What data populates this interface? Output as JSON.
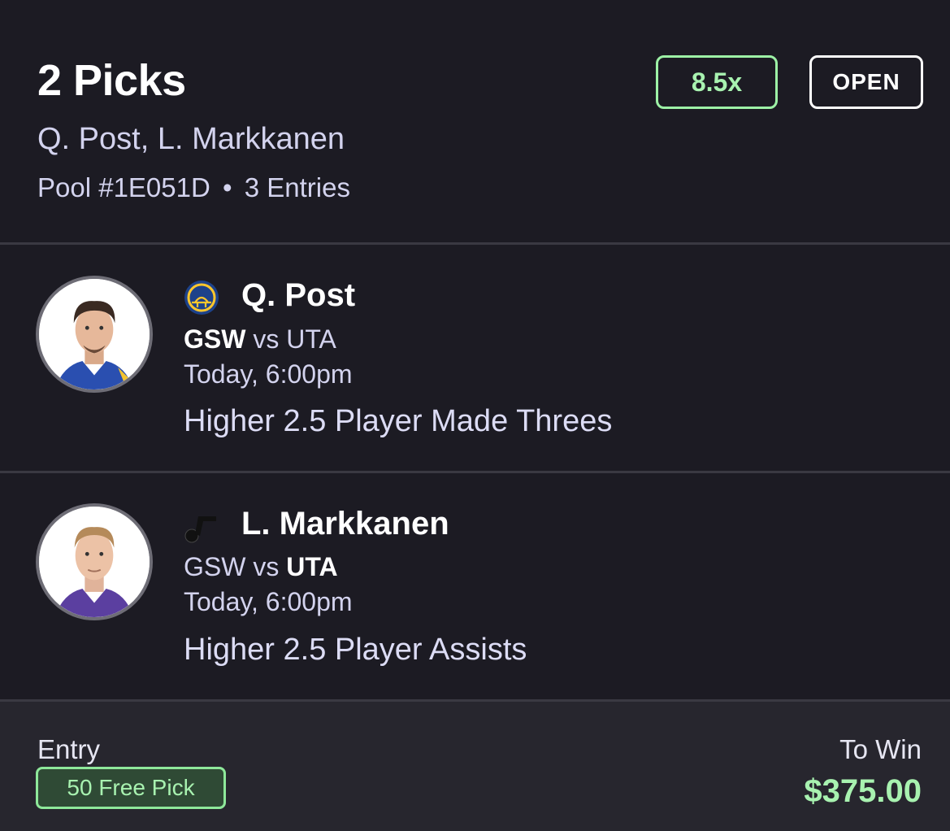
{
  "header": {
    "title": "2 Picks",
    "players": "Q. Post, L. Markkanen",
    "pool": "Pool #1E051D",
    "separator": "•",
    "entries": "3 Entries",
    "multiplier": "8.5x",
    "status": "OPEN"
  },
  "picks": [
    {
      "player": "Q. Post",
      "team_logo_icon": "warriors-logo-icon",
      "home_team": "GSW",
      "vs": "vs",
      "away_team": "UTA",
      "bold_team": "home",
      "time": "Today, 6:00pm",
      "line": "Higher 2.5 Player Made Threes",
      "jersey_color": "#2a4fb0"
    },
    {
      "player": "L. Markkanen",
      "team_logo_icon": "jazz-logo-icon",
      "home_team": "GSW",
      "vs": "vs",
      "away_team": "UTA",
      "bold_team": "away",
      "time": "Today, 6:00pm",
      "line": "Higher 2.5 Player Assists",
      "jersey_color": "#5b3fa0"
    }
  ],
  "footer": {
    "entry_label": "Entry",
    "entry_value": "50 Free Pick",
    "to_win_label": "To Win",
    "to_win_value": "$375.00"
  },
  "colors": {
    "background": "#1c1b23",
    "footer_background": "#27262e",
    "accent_green": "#a8f2b0",
    "divider": "#3a3942"
  }
}
